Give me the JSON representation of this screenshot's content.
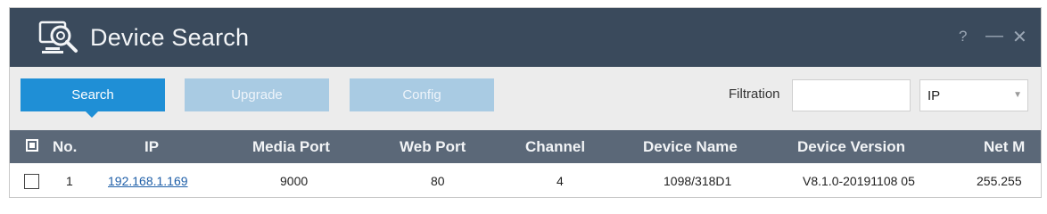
{
  "window": {
    "title": "Device Search",
    "help_label": "?",
    "minimize_label": "—",
    "close_label": "✕",
    "icon": "device-search-icon"
  },
  "toolbar": {
    "search_label": "Search",
    "upgrade_label": "Upgrade",
    "config_label": "Config",
    "filter_label": "Filtration",
    "filter_value": "",
    "filter_type": "IP",
    "filter_arrow": "▼"
  },
  "table": {
    "columns": [
      "No.",
      "IP",
      "Media Port",
      "Web Port",
      "Channel",
      "Device Name",
      "Device Version",
      "Net M"
    ],
    "rows": [
      {
        "no": "1",
        "ip": "192.168.1.169",
        "media_port": "9000",
        "web_port": "80",
        "channel": "4",
        "device_name": "1098/318D1",
        "device_version": "V8.1.0-20191108 05",
        "net_mask": "255.255"
      }
    ]
  },
  "colors": {
    "titlebar": "#3a4a5c",
    "accent": "#1f8fd6",
    "disabled_button": "#a9cbe3",
    "table_header": "#5b6878",
    "link": "#1f5fa8"
  }
}
